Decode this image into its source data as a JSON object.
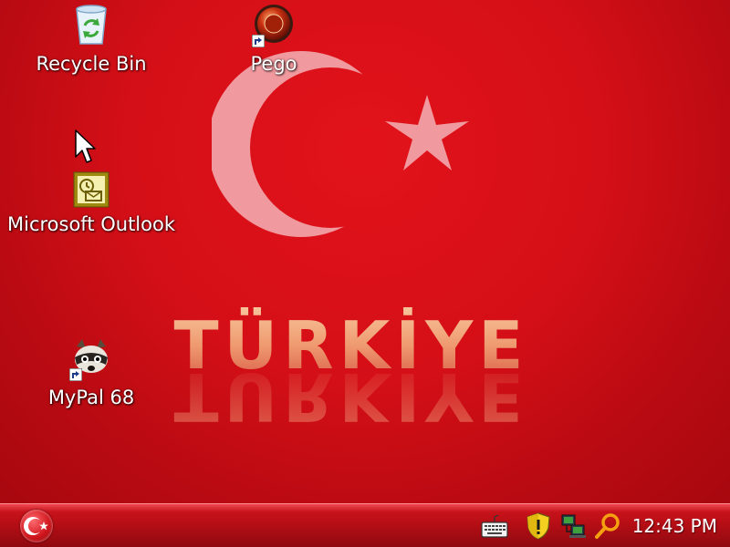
{
  "desktop": {
    "wallpaper": {
      "word": "TÜRKİYE",
      "colors": {
        "background": "#d50f17",
        "emblem": "#f2a9ad",
        "word_fill": "#f4b08a"
      }
    },
    "icons": [
      {
        "label": "Recycle Bin",
        "icon": "recycle-bin-icon"
      },
      {
        "label": "Pego",
        "icon": "pego-icon",
        "shortcut": true
      },
      {
        "label": "Microsoft Outlook",
        "icon": "outlook-icon"
      },
      {
        "label": "MyPal 68",
        "icon": "mypal-icon",
        "shortcut": true
      }
    ]
  },
  "taskbar": {
    "start_icon": "crescent-star-icon",
    "tray": [
      "keyboard-icon",
      "security-shield-icon",
      "network-icon",
      "search-icon"
    ],
    "clock": "12:43 PM",
    "colors": {
      "bar": "#b00d14"
    }
  }
}
